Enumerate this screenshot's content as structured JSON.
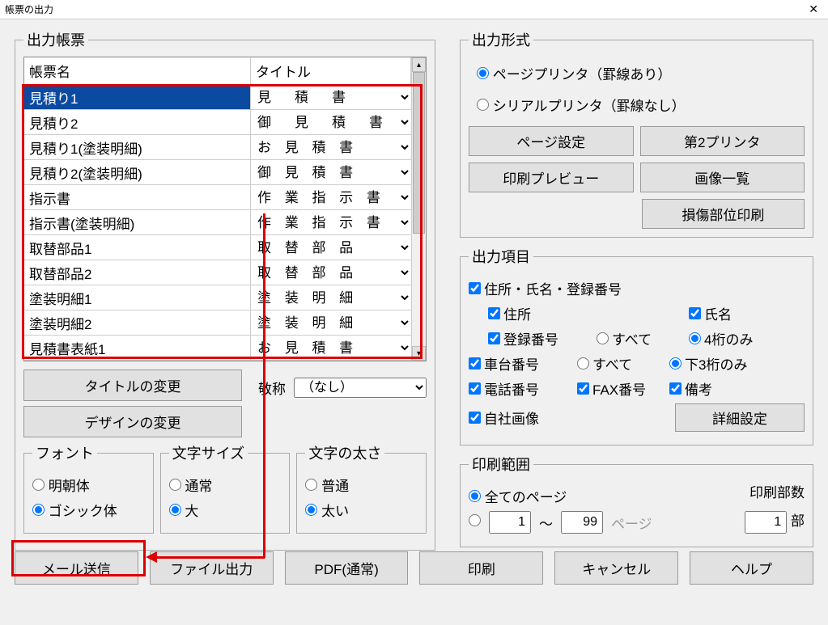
{
  "window": {
    "title": "帳票の出力"
  },
  "left": {
    "groupTitle": "出力帳票",
    "colName": "帳票名",
    "colTitle": "タイトル",
    "rows": [
      {
        "name": "見積り1",
        "title": "見　積　書",
        "selected": true
      },
      {
        "name": "見積り2",
        "title": "御　見　積　書"
      },
      {
        "name": "見積り1(塗装明細)",
        "title": "お 見 積 書"
      },
      {
        "name": "見積り2(塗装明細)",
        "title": "御 見 積 書"
      },
      {
        "name": "指示書",
        "title": "作 業 指 示 書"
      },
      {
        "name": "指示書(塗装明細)",
        "title": "作 業 指 示 書"
      },
      {
        "name": "取替部品1",
        "title": "取 替 部 品"
      },
      {
        "name": "取替部品2",
        "title": "取 替 部 品"
      },
      {
        "name": "塗装明細1",
        "title": "塗 装 明 細"
      },
      {
        "name": "塗装明細2",
        "title": "塗 装 明 細"
      },
      {
        "name": "見積書表紙1",
        "title": "お 見 積 書"
      }
    ],
    "titleChange": "タイトルの変更",
    "designChange": "デザインの変更",
    "honorificLabel": "敬称",
    "honorificValue": "（なし）",
    "fontGroup": "フォント",
    "fontOpts": [
      "明朝体",
      "ゴシック体"
    ],
    "fontSelected": "ゴシック体",
    "sizeGroup": "文字サイズ",
    "sizeOpts": [
      "通常",
      "大"
    ],
    "sizeSelected": "大",
    "weightGroup": "文字の太さ",
    "weightOpts": [
      "普通",
      "太い"
    ],
    "weightSelected": "太い"
  },
  "right": {
    "formatGroup": "出力形式",
    "formatOpts": [
      "ページプリンタ（罫線あり）",
      "シリアルプリンタ（罫線なし）"
    ],
    "formatSelected": "ページプリンタ（罫線あり）",
    "btnPageSetup": "ページ設定",
    "btnPrinter2": "第2プリンタ",
    "btnPreview": "印刷プレビュー",
    "btnImages": "画像一覧",
    "btnDamage": "損傷部位印刷",
    "itemsGroup": "出力項目",
    "chkAddrNameReg": "住所・氏名・登録番号",
    "chkAddress": "住所",
    "chkName": "氏名",
    "chkRegNo": "登録番号",
    "optAll": "すべて",
    "opt4digit": "4桁のみ",
    "chkChassis": "車台番号",
    "opt3digit": "下3桁のみ",
    "chkPhone": "電話番号",
    "chkFax": "FAX番号",
    "chkNote": "備考",
    "chkOwnImage": "自社画像",
    "btnDetail": "詳細設定",
    "rangeGroup": "印刷範囲",
    "rangeAll": "全てのページ",
    "rangeFrom": "1",
    "rangeTo": "99",
    "rangeTilde": "～",
    "rangePageSuffix": "ページ",
    "copiesLabel": "印刷部数",
    "copiesValue": "1",
    "copiesSuffix": "部"
  },
  "bottom": {
    "mail": "メール送信",
    "file": "ファイル出力",
    "pdf": "PDF(通常)",
    "print": "印刷",
    "cancel": "キャンセル",
    "help": "ヘルプ"
  }
}
